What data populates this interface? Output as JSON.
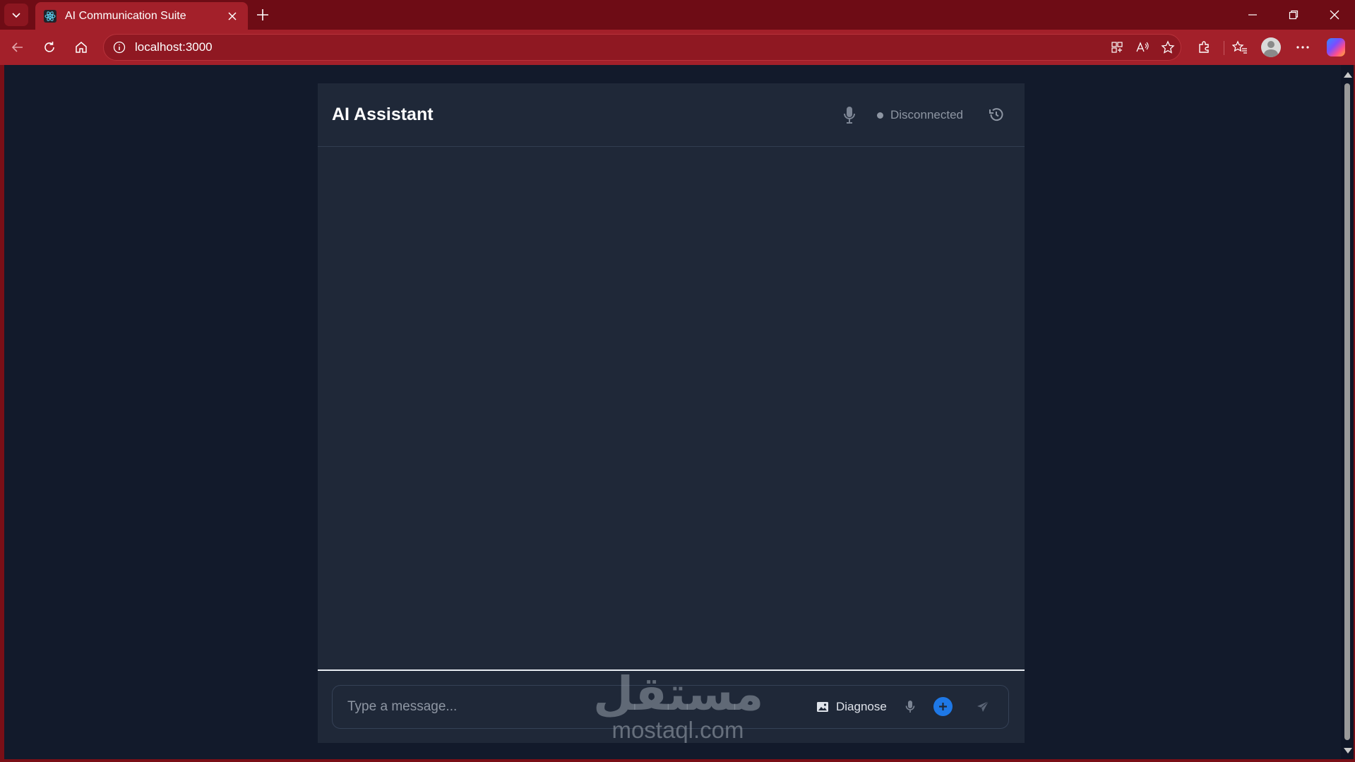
{
  "browser": {
    "tab_title": "AI Communication Suite",
    "url": "localhost:3000",
    "theme_color": "#a3202a"
  },
  "chat": {
    "title": "AI Assistant",
    "status": "Disconnected",
    "input_placeholder": "Type a message...",
    "diagnose_label": "Diagnose",
    "accent_color": "#1e78e6",
    "background_color": "#1f2838",
    "page_background": "#121a2b"
  },
  "icons": {
    "header": [
      "microphone-icon",
      "status-dot",
      "history-icon"
    ],
    "composer": [
      "image-icon",
      "microphone-icon",
      "plus-circle-icon",
      "send-icon"
    ]
  },
  "watermark": {
    "arabic": "مستقل",
    "latin": "mostaql.com"
  }
}
